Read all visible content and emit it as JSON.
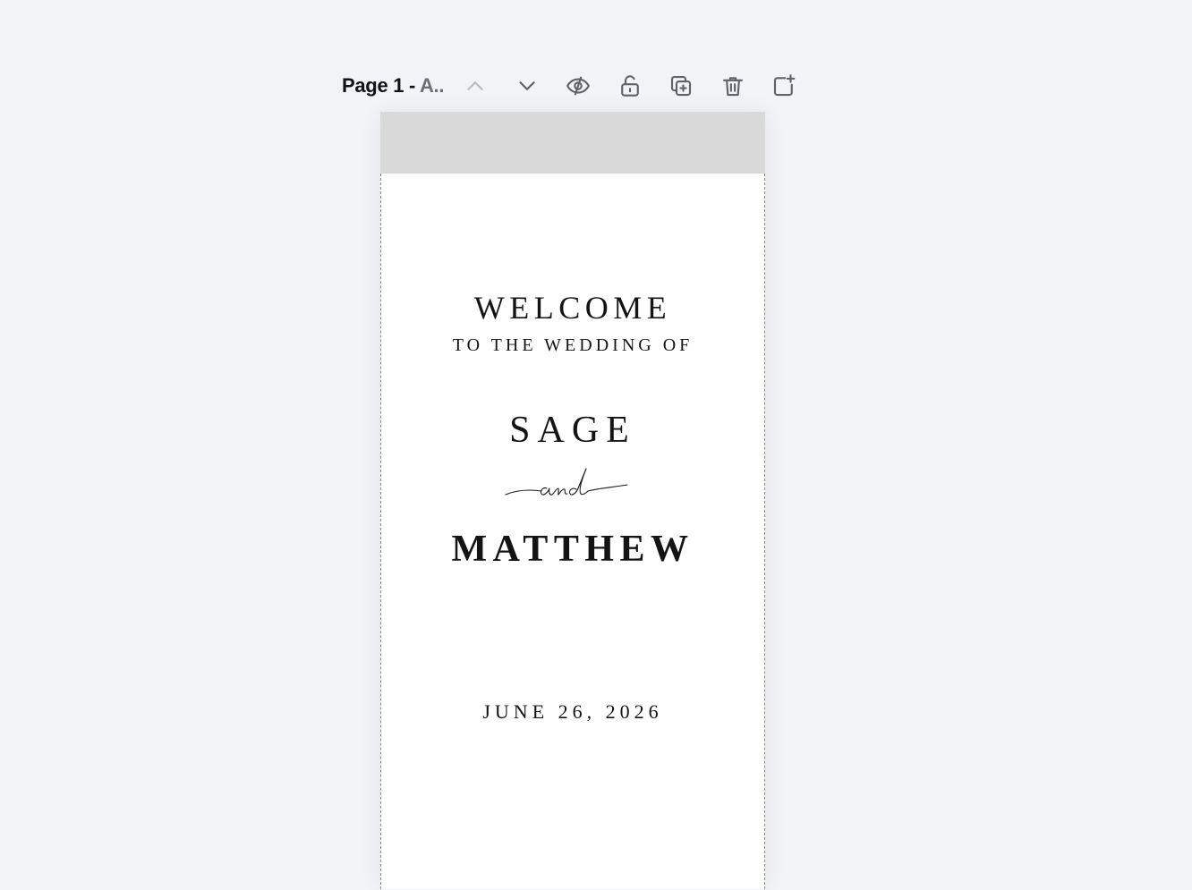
{
  "page_header": {
    "page_number_label": "Page 1 - ",
    "page_name_truncated": "A..",
    "buttons": {
      "move_up": "chevron-up-icon",
      "move_down": "chevron-down-icon",
      "hide": "eye-slash-icon",
      "lock": "unlock-icon",
      "duplicate": "duplicate-icon",
      "delete": "trash-icon",
      "add_page": "add-page-icon"
    }
  },
  "design": {
    "welcome": "WELCOME",
    "subtitle": "TO THE WEDDING OF",
    "name_one": "SAGE",
    "conjunction": "and",
    "name_two": "MATTHEW",
    "date": "JUNE 26, 2026"
  },
  "colors": {
    "workspace_bg": "#f2f3f7",
    "page_bg": "#ffffff",
    "top_band": "#d9d9d9",
    "text": "#141414",
    "icon": "#5f6368",
    "icon_disabled": "#b9bcc2"
  }
}
